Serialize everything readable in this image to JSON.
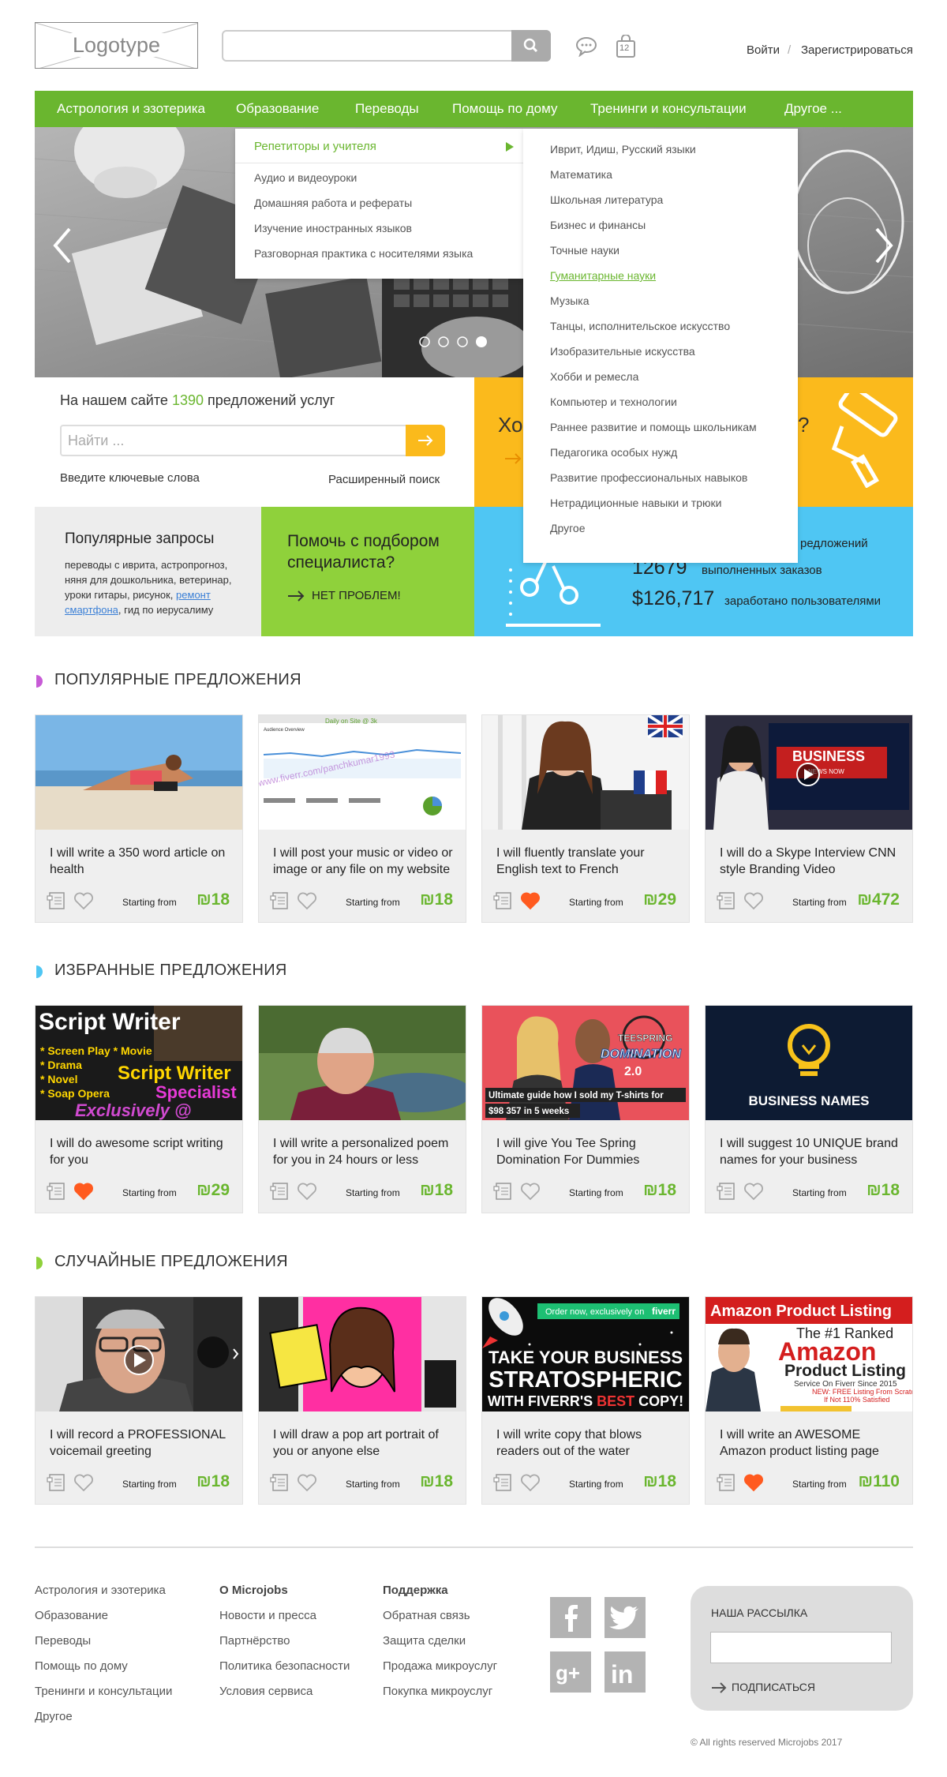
{
  "header": {
    "logo": "Logotype",
    "search_placeholder": "",
    "cart_count": "12",
    "login": "Войти",
    "separator": "/",
    "register": "Зарегистрироваться"
  },
  "nav": [
    "Астрология и эзотерика",
    "Образование",
    "Переводы",
    "Помощь по дому",
    "Тренинги и консультации",
    "Другое ..."
  ],
  "dropdown": {
    "left": {
      "active": "Репетиторы и учителя",
      "items": [
        "Аудио и видеоуроки",
        "Домашняя работа и рефераты",
        "Изучение иностранных языков",
        "Разговорная практика с носителями языка"
      ]
    },
    "right": [
      "Иврит, Идиш, Русский языки",
      "Математика",
      "Школьная литература",
      "Бизнес и финансы",
      "Точные науки",
      "Гуманитарные науки",
      "Музыка",
      "Танцы, исполнительское искусство",
      "Изобразительные искусства",
      "Хобби и ремесла",
      "Компьютер и технологии",
      "Раннее развитие и помощь школьникам",
      "Педагогика особых нужд",
      "Развитие профессиональных навыков",
      "Нетрадиционные навыки и трюки",
      "Другое"
    ],
    "right_active_index": 5
  },
  "offers": {
    "prefix": "На нашем сайте",
    "count": "1390",
    "suffix": "предложений услуг",
    "search_placeholder": "Найти ...",
    "hint": "Введите ключевые слова",
    "advanced": "Расширенный поиск"
  },
  "yellow": {
    "left_text": "Хо",
    "right_text": "?"
  },
  "popular": {
    "title": "Популярные запросы",
    "text_before": "переводы с иврита, астропрогноз, няня для дошкольника, ветеринар, уроки гитары, рисунок,",
    "link": "ремонт смартфона",
    "text_after": ", гид по иерусалиму"
  },
  "help": {
    "title": "Помочь с подбором специалиста?",
    "cta": "НЕТ ПРОБЛЕМ!"
  },
  "stats": [
    {
      "value": "",
      "label": "редложений"
    },
    {
      "value": "12679",
      "label": "выполненных заказов"
    },
    {
      "value": "$126,717",
      "label": "заработано пользователями"
    }
  ],
  "currency": "₪",
  "starting_from": "Starting from",
  "sections": [
    {
      "title": "ПОПУЛЯРНЫЕ ПРЕДЛОЖЕНИЯ",
      "color": "#c75bd6",
      "cards": [
        {
          "title": "I will write a 350 word article on health",
          "price": "18",
          "liked": false,
          "img": "beach"
        },
        {
          "title": "I will post your music or video or image or any file on my website",
          "price": "18",
          "liked": false,
          "img": "analytics"
        },
        {
          "title": "I will fluently translate your English text to French",
          "price": "29",
          "liked": true,
          "img": "translator"
        },
        {
          "title": "I will do a Skype Interview CNN style Branding Video",
          "price": "472",
          "liked": false,
          "img": "news"
        }
      ]
    },
    {
      "title": "ИЗБРАННЫЕ ПРЕДЛОЖЕНИЯ",
      "color": "#4fc6f3",
      "cards": [
        {
          "title": "I will do awesome script writing for you",
          "price": "29",
          "liked": true,
          "img": "script"
        },
        {
          "title": "I will write a personalized poem for you in 24 hours or less",
          "price": "18",
          "liked": false,
          "img": "man"
        },
        {
          "title": "I will give You Tee Spring Domination For Dummies",
          "price": "18",
          "liked": false,
          "img": "teespring"
        },
        {
          "title": "I will suggest 10 UNIQUE brand names for your business",
          "price": "18",
          "liked": false,
          "img": "bulb"
        }
      ]
    },
    {
      "title": "СЛУЧАЙНЫЕ ПРЕДЛОЖЕНИЯ",
      "color": "#8fd13b",
      "cards": [
        {
          "title": "I will record a PROFESSIONAL voicemail greeting",
          "price": "18",
          "liked": false,
          "img": "voice"
        },
        {
          "title": "I will draw a pop art portrait of you or anyone else",
          "price": "18",
          "liked": false,
          "img": "popart"
        },
        {
          "title": "I will write copy that blows readers out of the water",
          "price": "18",
          "liked": false,
          "img": "rocket"
        },
        {
          "title": "I will write an AWESOME Amazon product listing page",
          "price": "110",
          "liked": true,
          "img": "amazon"
        }
      ]
    }
  ],
  "card_texts": {
    "script": {
      "l1": "Script Writer",
      "l2": "* Screen Play  * Movie",
      "l3": "* Drama",
      "l4": "* Novel",
      "l5": "* Soap Opera",
      "r1": "Script Writer",
      "r2": "Specialist",
      "bottom": "Exclusively @"
    },
    "teespring": {
      "l1": "TEESPRING",
      "l2": "DOMINATION",
      "l3": "2.0",
      "l4": "Ultimate guide how I sold my T-shirts for",
      "l5": "$98 357 in 5 weeks"
    },
    "bulb": {
      "l1": "BUSINESS NAMES"
    },
    "news": {
      "l1": "BUSINESS",
      "l2": "NEWS NOW"
    },
    "rocket": {
      "l1": "Order now, exclusively on",
      "l2": "fiverr",
      "l3": "TAKE YOUR BUSINESS",
      "l4": "STRATOSPHERIC",
      "l5": "WITH FIVERR'S",
      "l6": "BEST",
      "l7": "COPY!"
    },
    "amazon": {
      "l1": "Amazon Product Listing",
      "l2": "The #1 Ranked",
      "l3": "Amazon",
      "l4": "Product Listing",
      "l5": "Service On Fiverr Since 2015",
      "l6": "NEW: FREE Listing From Scratch",
      "l7": "If Not 110% Satisfied"
    },
    "analytics": {
      "l1": "Audience Overview",
      "l2": "Daily on Site @ 3k",
      "l3": "www.fiverr.com/panchkumar1993"
    }
  },
  "footer": {
    "col1": [
      "Астрология и эзотерика",
      "Образование",
      "Переводы",
      "Помощь по дому",
      "Тренинги и консультации",
      "Другое"
    ],
    "col2_title": "О Microjobs",
    "col2": [
      "Новости и пресса",
      "Партнёрство",
      "Политика безопасности",
      "Условия сервиса"
    ],
    "col3_title": "Поддержка",
    "col3": [
      "Обратная связь",
      "Защита сделки",
      "Продажа микроуслуг",
      "Покупка микроуслуг"
    ],
    "newsletter_title": "НАША РАССЫЛКА",
    "subscribe": "ПОДПИСАТЬСЯ",
    "copyright": "© All rights reserved Microjobs 2017"
  },
  "colors": {
    "green": "#6ab62f",
    "yellow": "#fbba1c",
    "blue": "#4fc6f3",
    "lime": "#8fd13b",
    "like": "#ff5a1f",
    "purple": "#c75bd6"
  }
}
